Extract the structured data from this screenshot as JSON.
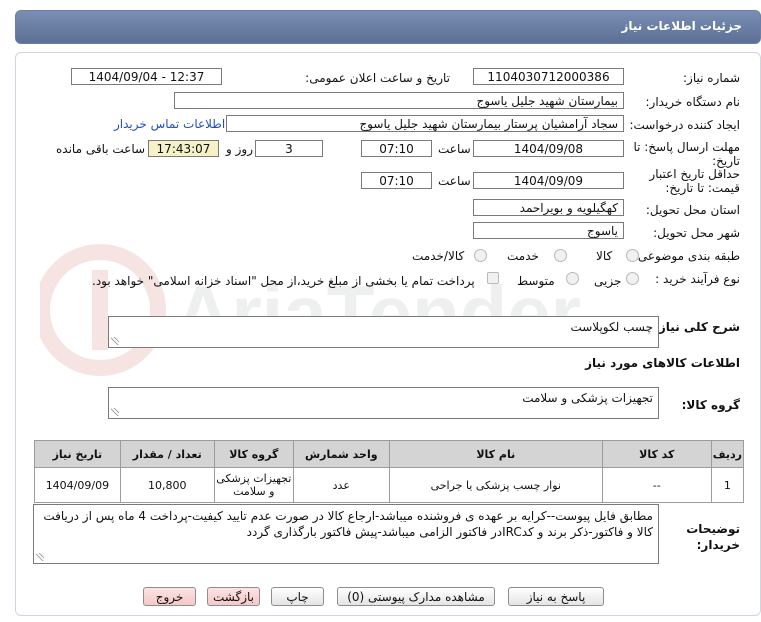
{
  "header": {
    "title": "جزئیات اطلاعات نیاز"
  },
  "watermark": {
    "text": "AriaTender.net"
  },
  "fields": {
    "need_number": {
      "label": "شماره نیاز:",
      "value": "1104030712000386"
    },
    "announce": {
      "label": "تاریخ و ساعت اعلان عمومی:",
      "value": "1404/09/04 - 12:37"
    },
    "buyer": {
      "label": "نام دستگاه خریدار:",
      "value": "بیمارستان شهید جلیل یاسوج"
    },
    "creator": {
      "label": "ایجاد کننده درخواست:",
      "value": "سجاد آرامشیان پرستار بیمارستان شهید جلیل یاسوج",
      "contact_link": "اطلاعات تماس خریدار"
    },
    "deadline": {
      "label": "مهلت ارسال پاسخ: تا تاریخ:",
      "date": "1404/09/08",
      "time_label": "ساعت",
      "time": "07:10",
      "days": "3",
      "days_label": "روز و",
      "remaining": "17:43:07",
      "remaining_label": "ساعت باقی مانده"
    },
    "validity": {
      "label": "حداقل تاریخ اعتبار قیمت: تا تاریخ:",
      "date": "1404/09/09",
      "time_label": "ساعت",
      "time": "07:10"
    },
    "province": {
      "label": "استان محل تحویل:",
      "value": "کهگیلویه و بویراحمد"
    },
    "city": {
      "label": "شهر محل تحویل:",
      "value": "یاسوج"
    },
    "category": {
      "label": "طبقه بندی موضوعی:",
      "options": [
        "کالا",
        "خدمت",
        "کالا/خدمت"
      ]
    },
    "process": {
      "label": "نوع فرآیند خرید :",
      "options": [
        "جزیی",
        "متوسط"
      ],
      "payment_note": "پرداخت تمام یا بخشی از مبلغ خرید،از محل \"اسناد خزانه اسلامی\" خواهد بود."
    }
  },
  "description": {
    "label": "شرح کلی نیاز:",
    "value": "چسب لکوپلاست"
  },
  "goods_section": {
    "title": "اطلاعات کالاهای مورد نیاز"
  },
  "goods_group": {
    "label": "گروه کالا:",
    "value": "تجهیزات پزشکی و سلامت"
  },
  "table": {
    "headers": [
      "ردیف",
      "کد کالا",
      "نام کالا",
      "واحد شمارش",
      "گروه کالا",
      "تعداد / مقدار",
      "تاریخ نیاز"
    ],
    "rows": [
      [
        "1",
        "--",
        "نوار چسب پزشکی یا جراحی",
        "عدد",
        "تجهیزات پزشکی و سلامت",
        "10,800",
        "1404/09/09"
      ]
    ]
  },
  "buyer_notes": {
    "label": "توضیحات خریدار:",
    "value": "مطابق فایل پیوست--کرایه بر عهده ی فروشنده میباشد-ارجاع کالا در صورت عدم تایید کیفیت-پرداخت 4 ماه پس از دریافت کالا و فاکتور-ذکر برند و کدIRCدر فاکتور الزامی میباشد-پیش فاکتور بارگذاری گردد"
  },
  "buttons": {
    "reply": "پاسخ به نیاز",
    "attachments": "مشاهده مدارک پیوستی (0)",
    "print": "چاپ",
    "back": "بازگشت",
    "exit": "خروج"
  }
}
